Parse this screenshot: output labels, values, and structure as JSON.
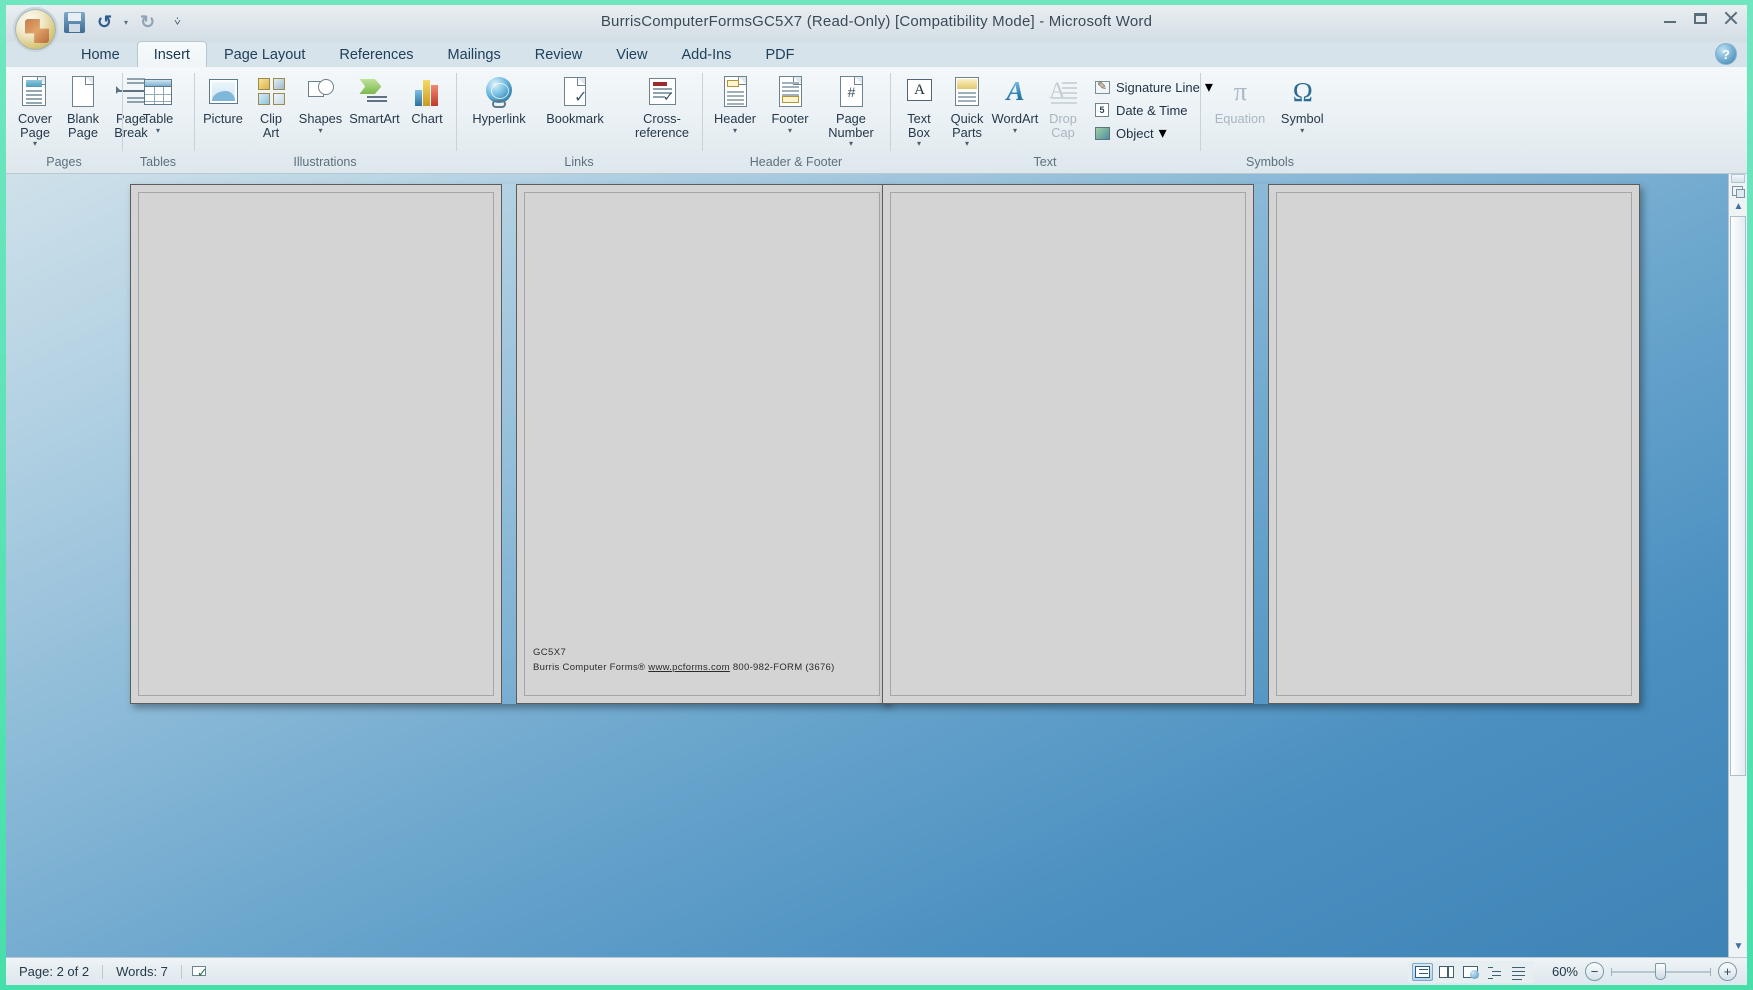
{
  "window": {
    "title": "BurrisComputerFormsGC5X7 (Read-Only) [Compatibility Mode] - Microsoft Word",
    "minimize_label": "Minimize",
    "maximize_label": "Maximize",
    "close_label": "Close",
    "help_label": "?"
  },
  "quick_access": {
    "office_button": "Office Button",
    "save": "Save",
    "undo": "Undo",
    "undo_caret": "▾",
    "redo": "Redo",
    "customize": "▾"
  },
  "tabs": [
    {
      "label": "Home",
      "active": false
    },
    {
      "label": "Insert",
      "active": true
    },
    {
      "label": "Page Layout",
      "active": false
    },
    {
      "label": "References",
      "active": false
    },
    {
      "label": "Mailings",
      "active": false
    },
    {
      "label": "Review",
      "active": false
    },
    {
      "label": "View",
      "active": false
    },
    {
      "label": "Add-Ins",
      "active": false
    },
    {
      "label": "PDF",
      "active": false
    }
  ],
  "ribbon": {
    "groups": [
      {
        "name": "Pages",
        "label": "Pages",
        "buttons": [
          {
            "label": "Cover\nPage",
            "caret": "▾",
            "icon": "cover-page-icon",
            "disabled": false
          },
          {
            "label": "Blank\nPage",
            "caret": "",
            "icon": "blank-page-icon",
            "disabled": false
          },
          {
            "label": "Page\nBreak",
            "caret": "",
            "icon": "page-break-icon",
            "disabled": false
          }
        ]
      },
      {
        "name": "Tables",
        "label": "Tables",
        "buttons": [
          {
            "label": "Table",
            "caret": "▾",
            "icon": "table-icon",
            "disabled": false
          }
        ]
      },
      {
        "name": "Illustrations",
        "label": "Illustrations",
        "buttons": [
          {
            "label": "Picture",
            "caret": "",
            "icon": "picture-icon",
            "disabled": false
          },
          {
            "label": "Clip\nArt",
            "caret": "",
            "icon": "clip-art-icon",
            "disabled": false
          },
          {
            "label": "Shapes",
            "caret": "▾",
            "icon": "shapes-icon",
            "disabled": false
          },
          {
            "label": "SmartArt",
            "caret": "",
            "icon": "smartart-icon",
            "disabled": false
          },
          {
            "label": "Chart",
            "caret": "",
            "icon": "chart-icon",
            "disabled": false
          }
        ]
      },
      {
        "name": "Links",
        "label": "Links",
        "buttons": [
          {
            "label": "Hyperlink",
            "caret": "",
            "icon": "hyperlink-icon",
            "disabled": false
          },
          {
            "label": "Bookmark",
            "caret": "",
            "icon": "bookmark-icon",
            "disabled": false
          },
          {
            "label": "Cross-reference",
            "caret": "",
            "icon": "cross-reference-icon",
            "disabled": false
          }
        ]
      },
      {
        "name": "Header & Footer",
        "label": "Header & Footer",
        "buttons": [
          {
            "label": "Header",
            "caret": "▾",
            "icon": "header-icon",
            "disabled": false
          },
          {
            "label": "Footer",
            "caret": "▾",
            "icon": "footer-icon",
            "disabled": false
          },
          {
            "label": "Page\nNumber",
            "caret": "▾",
            "icon": "page-number-icon",
            "disabled": false
          }
        ]
      },
      {
        "name": "Text",
        "label": "Text",
        "buttons": [
          {
            "label": "Text\nBox",
            "caret": "▾",
            "icon": "text-box-icon",
            "disabled": false
          },
          {
            "label": "Quick\nParts",
            "caret": "▾",
            "icon": "quick-parts-icon",
            "disabled": false
          },
          {
            "label": "WordArt",
            "caret": "▾",
            "icon": "wordart-icon",
            "disabled": false
          },
          {
            "label": "Drop\nCap",
            "caret": "",
            "icon": "drop-cap-icon",
            "disabled": true
          }
        ],
        "small_buttons": [
          {
            "label": "Signature Line",
            "caret": "▾",
            "icon": "signature-line-icon"
          },
          {
            "label": "Date & Time",
            "caret": "",
            "icon": "date-time-icon"
          },
          {
            "label": "Object",
            "caret": "▾",
            "icon": "object-icon"
          }
        ]
      },
      {
        "name": "Symbols",
        "label": "Symbols",
        "buttons": [
          {
            "label": "Equation",
            "caret": "",
            "icon": "equation-icon",
            "glyph": "π",
            "disabled": true
          },
          {
            "label": "Symbol",
            "caret": "▾",
            "icon": "symbol-icon",
            "glyph": "Ω",
            "disabled": false
          }
        ]
      }
    ]
  },
  "document": {
    "page_text": {
      "line1": "GC5X7",
      "line2_prefix": "Burris Computer Forms",
      "line2_mark": "®",
      "line2_link": "www.pcforms.com",
      "line2_suffix": "800-982-FORM (3676)"
    }
  },
  "scrollbar": {
    "up_arrow": "▲",
    "down_arrow": "▼",
    "previous_page": "▲",
    "next_page": "▼",
    "select_browse_object": "Select Browse Object"
  },
  "statusbar": {
    "page": "Page: 2 of 2",
    "words": "Words: 7",
    "proofing": "Proofing errors icon",
    "views": [
      {
        "name": "print-layout",
        "label": "Print Layout",
        "active": true
      },
      {
        "name": "full-screen-reading",
        "label": "Full Screen Reading",
        "active": false
      },
      {
        "name": "web-layout",
        "label": "Web Layout",
        "active": false
      },
      {
        "name": "outline",
        "label": "Outline",
        "active": false
      },
      {
        "name": "draft",
        "label": "Draft",
        "active": false
      }
    ],
    "zoom": "60%",
    "zoom_out": "−",
    "zoom_in": "+"
  },
  "colors": {
    "frame": "#47dfa9",
    "titlebar": "#dfe7ec",
    "ribbon": "#e9f0f4",
    "desktop_blue": "#4a8fc0",
    "page": "#d4d4d4",
    "accent_tab": "#17364f"
  }
}
